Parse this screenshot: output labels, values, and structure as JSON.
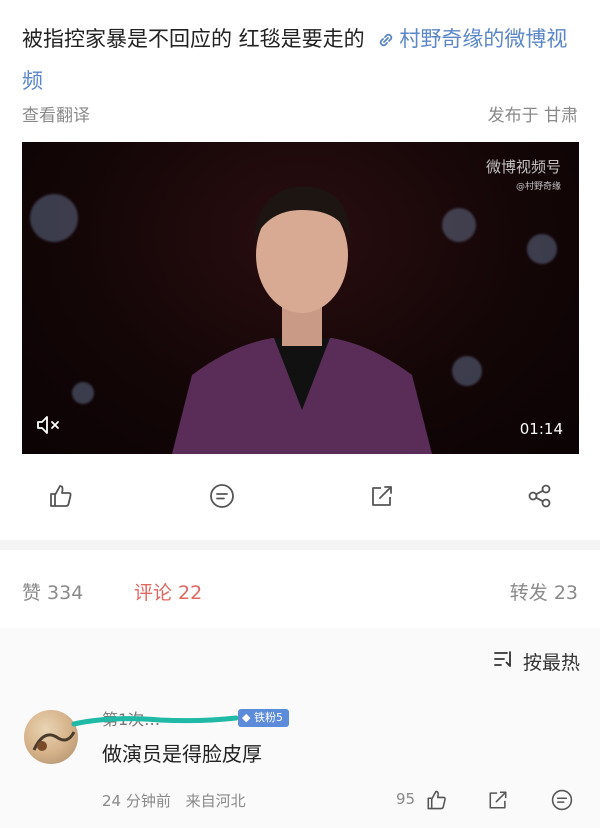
{
  "post": {
    "text": "被指控家暴是不回应的 红毯是要走的",
    "link_label": "村野奇缘的微博视频",
    "translate_label": "查看翻译",
    "location_label": "发布于 甘肃"
  },
  "video": {
    "watermark": "微博视频号",
    "watermark_sub": "@村野奇缘",
    "duration": "01:14"
  },
  "actions": {
    "like_icon": "thumb-up-icon",
    "comment_icon": "comment-icon",
    "repost_icon": "share-box-icon",
    "share_icon": "share-icon"
  },
  "stats": {
    "likes": "赞 334",
    "comments": "评论 22",
    "reposts": "转发 23"
  },
  "comments": {
    "sort_label": "按最热",
    "items": [
      {
        "username": "第1次…",
        "badge": "铁粉5",
        "text": "做演员是得脸皮厚",
        "time": "24 分钟前",
        "location": "来自河北",
        "like_count": "95"
      }
    ]
  },
  "colors": {
    "link": "#5b86c7",
    "accent_comment": "#e0665f",
    "badge": "#5c8bd9",
    "redaction": "#1fb9a6"
  }
}
